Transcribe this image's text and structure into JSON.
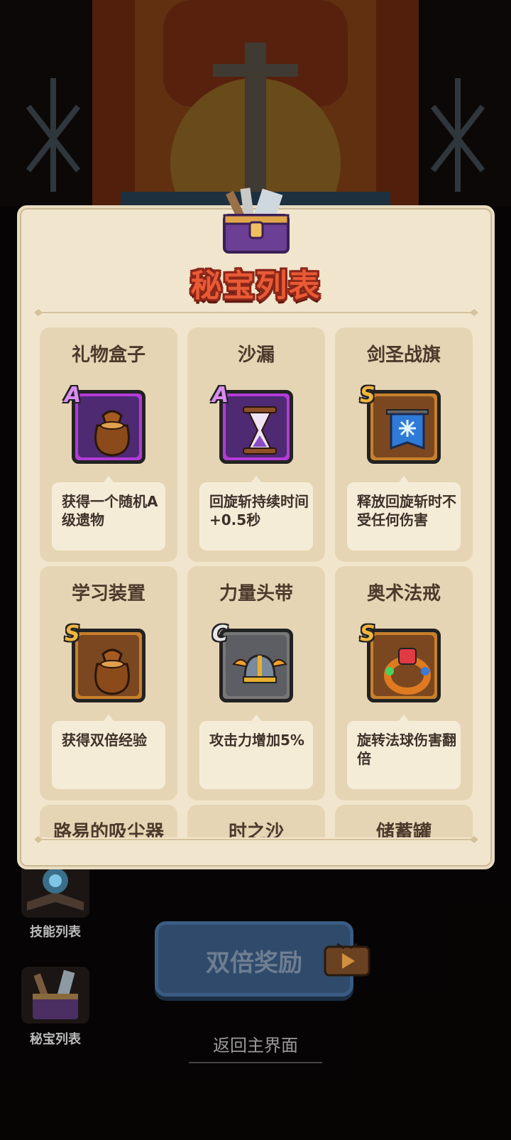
{
  "modal": {
    "title": "秘宝列表",
    "items": [
      {
        "name": "礼物盒子",
        "rank": "A",
        "icon": "gift-bag-icon",
        "description": "获得一个随机A级遗物",
        "frame_color": "#b33bd6"
      },
      {
        "name": "沙漏",
        "rank": "A",
        "icon": "hourglass-icon",
        "description": "回旋斩持续时间+0.5秒",
        "frame_color": "#b33bd6"
      },
      {
        "name": "剑圣战旗",
        "rank": "S",
        "icon": "banner-icon",
        "description": "释放回旋斩时不受任何伤害",
        "frame_color": "#c8802c"
      },
      {
        "name": "学习装置",
        "rank": "S",
        "icon": "gift-bag-icon",
        "description": "获得双倍经验",
        "frame_color": "#c8802c"
      },
      {
        "name": "力量头带",
        "rank": "C",
        "icon": "winged-helmet-icon",
        "description": "攻击力增加5%",
        "frame_color": "#777777"
      },
      {
        "name": "奥术法戒",
        "rank": "S",
        "icon": "ring-icon",
        "description": "旋转法球伤害翻倍",
        "frame_color": "#c8802c"
      },
      {
        "name": "路易的吸尘器",
        "rank": "",
        "icon": "",
        "description": "",
        "frame_color": ""
      },
      {
        "name": "时之沙",
        "rank": "",
        "icon": "",
        "description": "",
        "frame_color": ""
      },
      {
        "name": "储蓄罐",
        "rank": "",
        "icon": "",
        "description": "",
        "frame_color": ""
      }
    ]
  },
  "sidebar": {
    "skills_label": "技能列表",
    "treasures_label": "秘宝列表"
  },
  "double_reward": {
    "label": "双倍奖励"
  },
  "return_link": {
    "label": "返回主界面"
  },
  "colors": {
    "panel": "#f1e6cd",
    "card": "#e6d5b4",
    "title_outline": "#8a2619"
  }
}
